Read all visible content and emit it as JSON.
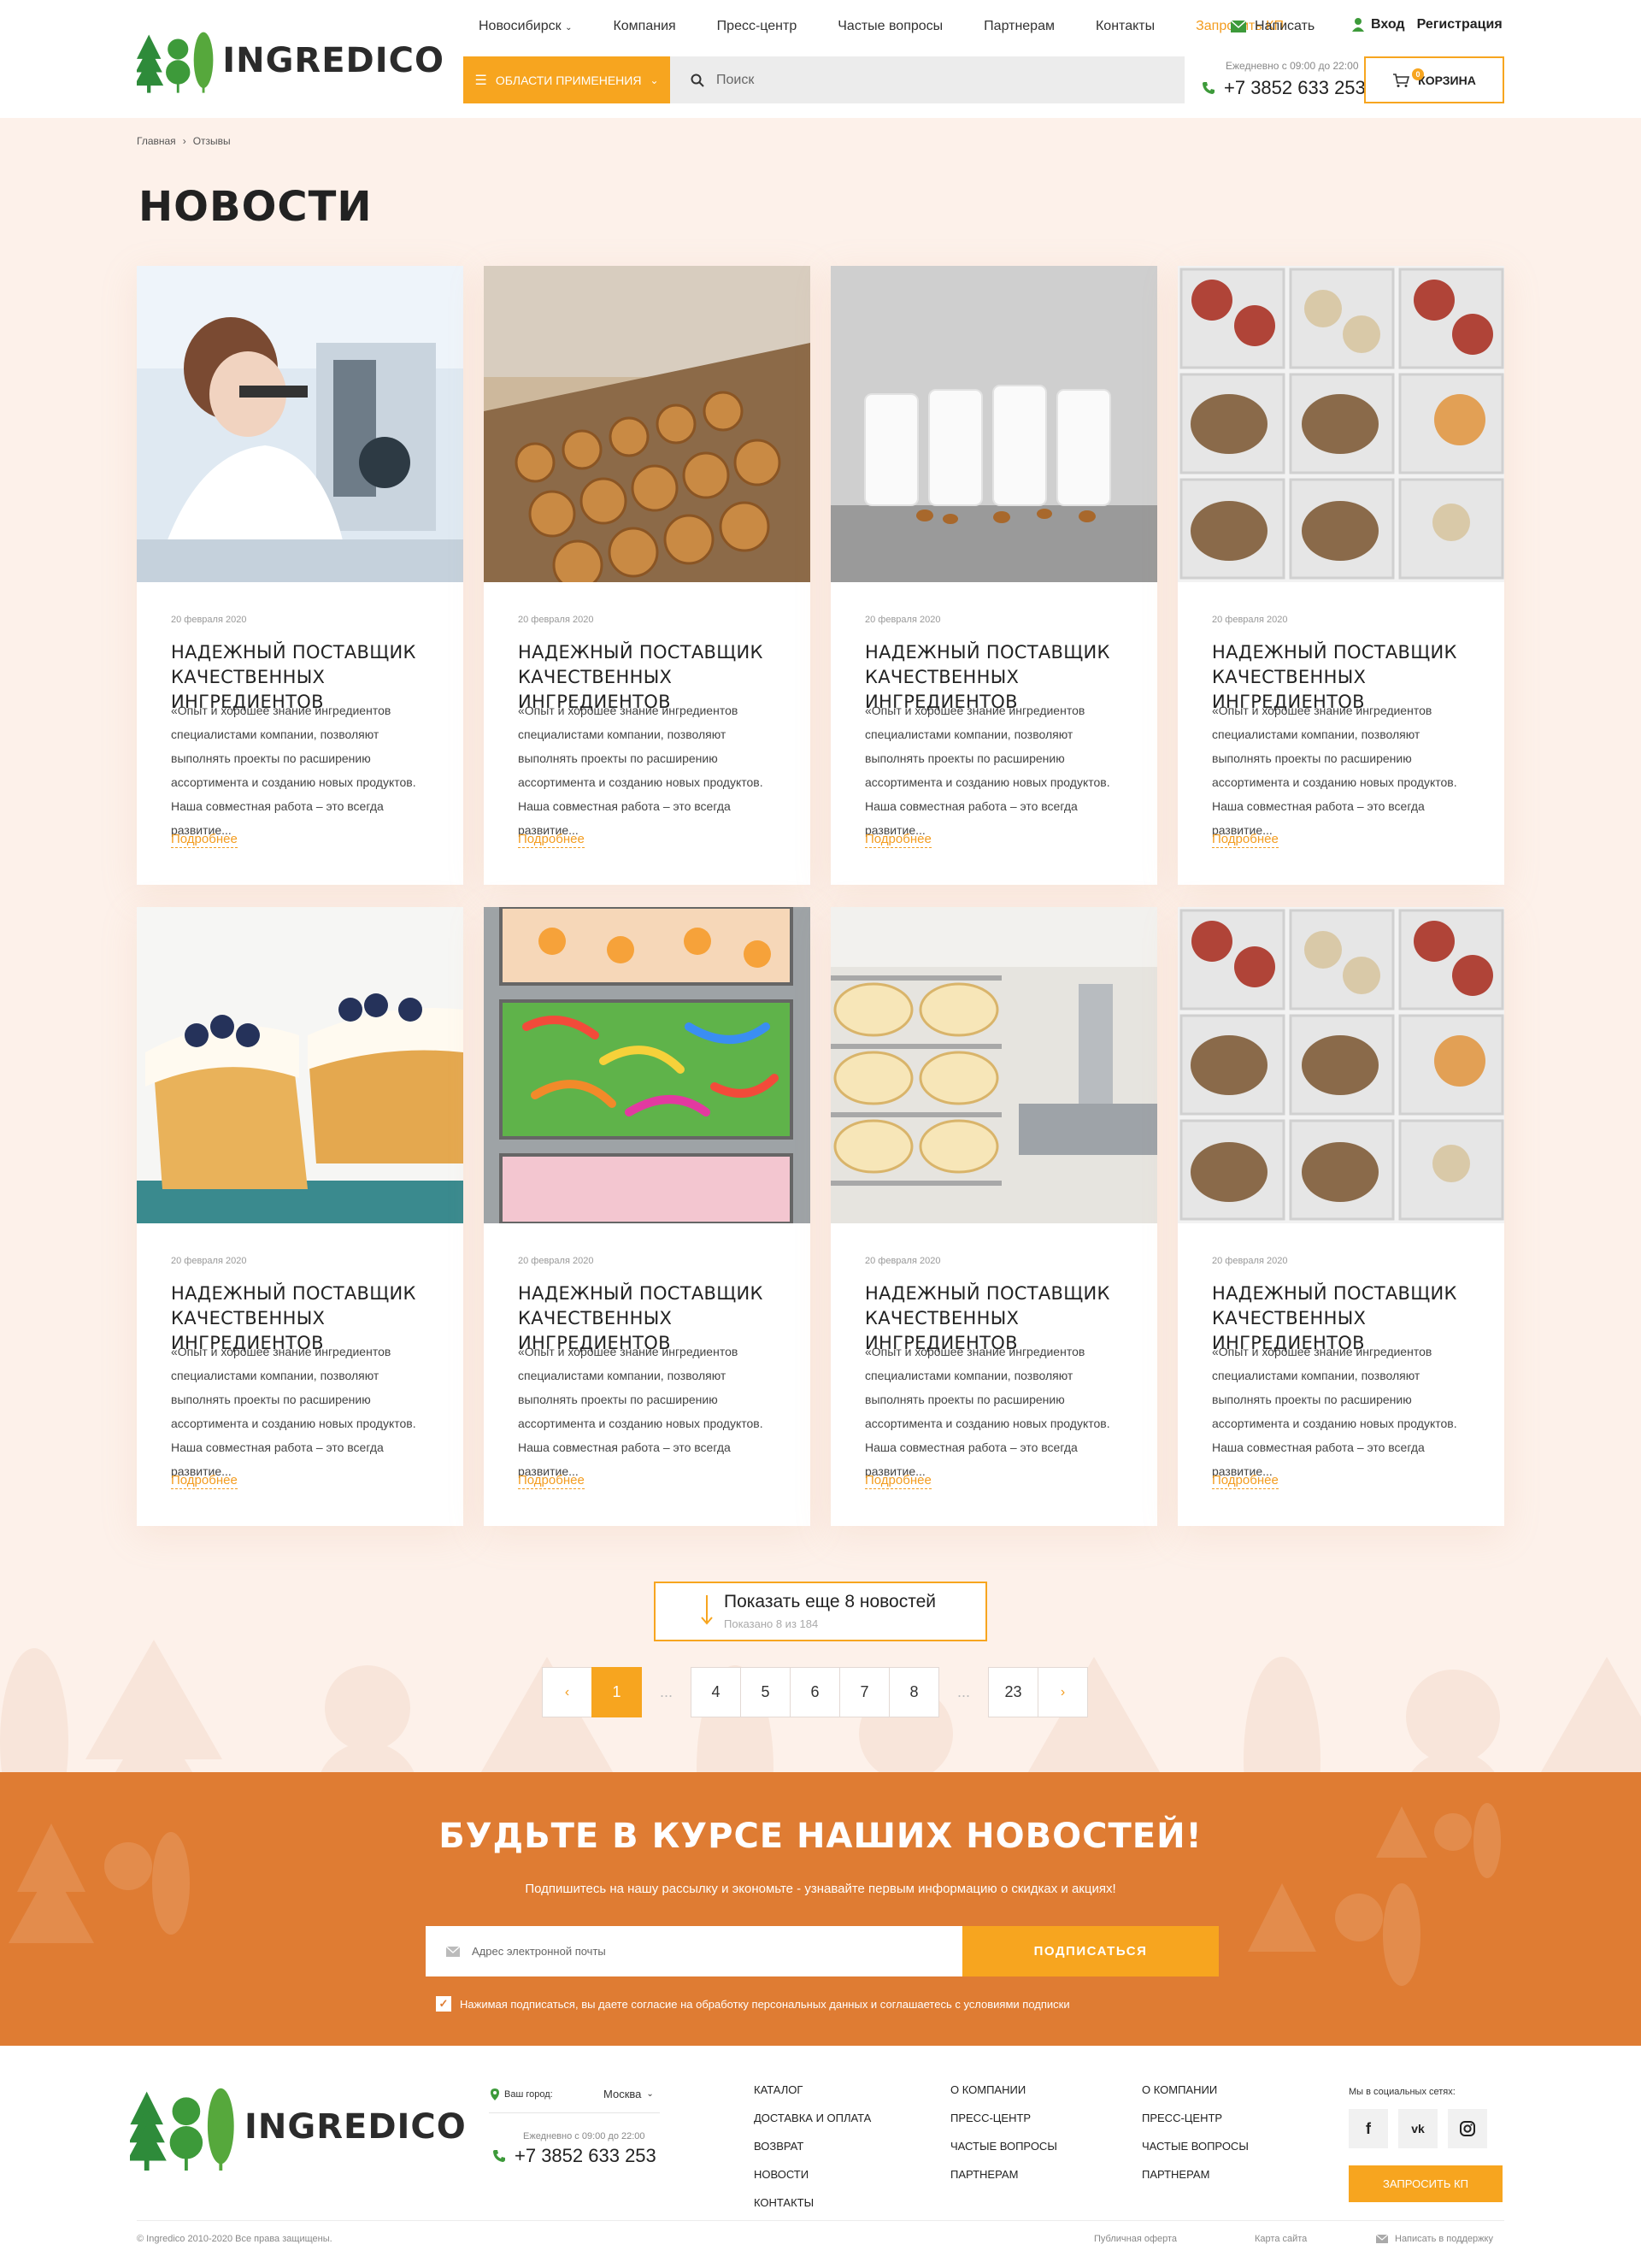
{
  "header": {
    "logo_text": "INGREDICO",
    "nav": {
      "city": "Новосибирск",
      "items": [
        "Компания",
        "Пресс-центр",
        "Частые вопросы",
        "Партнерам",
        "Контакты"
      ],
      "request_kp": "Запросить КП"
    },
    "write": "Написать",
    "login": "Вход",
    "register": "Регистрация",
    "categories_button": "Области применения",
    "search_placeholder": "Поиск",
    "hours": "Ежедневно с 09:00 до 22:00",
    "phone": "+7 3852 633 253",
    "cart_label": "Корзина",
    "cart_count": "0"
  },
  "breadcrumb": [
    "Главная",
    "Отзывы"
  ],
  "page_title": "НОВОСТИ",
  "news": [
    {
      "date": "20 февраля 2020",
      "title": "НАДЕЖНЫЙ ПОСТАВЩИК КАЧЕСТВЕННЫХ ИНГРЕДИЕНТОВ",
      "text": "«Опыт и хорошее знание ингредиентов специалистами компании, позволяют выполнять проекты по расширению ассортимента и созданию новых продуктов. Наша совместная работа – это всегда развитие...",
      "more": "Подробнее",
      "image": "laboratory"
    },
    {
      "date": "20 февраля 2020",
      "title": "НАДЕЖНЫЙ ПОСТАВЩИК КАЧЕСТВЕННЫХ ИНГРЕДИЕНТОВ",
      "text": "«Опыт и хорошее знание ингредиентов специалистами компании, позволяют выполнять проекты по расширению ассортимента и созданию новых продуктов. Наша совместная работа – это всегда развитие...",
      "more": "Подробнее",
      "image": "cookies"
    },
    {
      "date": "20 февраля 2020",
      "title": "НАДЕЖНЫЙ ПОСТАВЩИК КАЧЕСТВЕННЫХ ИНГРЕДИЕНТОВ",
      "text": "«Опыт и хорошее знание ингредиентов специалистами компании, позволяют выполнять проекты по расширению ассортимента и созданию новых продуктов. Наша совместная работа – это всегда развитие...",
      "more": "Подробнее",
      "image": "milk"
    },
    {
      "date": "20 февраля 2020",
      "title": "НАДЕЖНЫЙ ПОСТАВЩИК КАЧЕСТВЕННЫХ ИНГРЕДИЕНТОВ",
      "text": "«Опыт и хорошее знание ингредиентов специалистами компании, позволяют выполнять проекты по расширению ассортимента и созданию новых продуктов. Наша совместная работа – это всегда развитие...",
      "more": "Подробнее",
      "image": "meat"
    },
    {
      "date": "20 февраля 2020",
      "title": "НАДЕЖНЫЙ ПОСТАВЩИК КАЧЕСТВЕННЫХ ИНГРЕДИЕНТОВ",
      "text": "«Опыт и хорошее знание ингредиентов специалистами компании, позволяют выполнять проекты по расширению ассортимента и созданию новых продуктов. Наша совместная работа – это всегда развитие...",
      "more": "Подробнее",
      "image": "cake"
    },
    {
      "date": "20 февраля 2020",
      "title": "НАДЕЖНЫЙ ПОСТАВЩИК КАЧЕСТВЕННЫХ ИНГРЕДИЕНТОВ",
      "text": "«Опыт и хорошее знание ингредиентов специалистами компании, позволяют выполнять проекты по расширению ассортимента и созданию новых продуктов. Наша совместная работа – это всегда развитие...",
      "more": "Подробнее",
      "image": "candy"
    },
    {
      "date": "20 февраля 2020",
      "title": "НАДЕЖНЫЙ ПОСТАВЩИК КАЧЕСТВЕННЫХ ИНГРЕДИЕНТОВ",
      "text": "«Опыт и хорошее знание ингредиентов специалистами компании, позволяют выполнять проекты по расширению ассортимента и созданию новых продуктов. Наша совместная работа – это всегда развитие...",
      "more": "Подробнее",
      "image": "cakes-factory"
    },
    {
      "date": "20 февраля 2020",
      "title": "НАДЕЖНЫЙ ПОСТАВЩИК КАЧЕСТВЕННЫХ ИНГРЕДИЕНТОВ",
      "text": "«Опыт и хорошее знание ингредиентов специалистами компании, позволяют выполнять проекты по расширению ассортимента и созданию новых продуктов. Наша совместная работа – это всегда развитие...",
      "more": "Подробнее",
      "image": "meat"
    }
  ],
  "show_more": {
    "label": "Показать еще 8 новостей",
    "shown": "Показано 8 из 184"
  },
  "pagination": {
    "prev": "‹",
    "next": "›",
    "pages": [
      "1",
      "...",
      "4",
      "5",
      "6",
      "7",
      "8",
      "...",
      "23"
    ],
    "current": "1"
  },
  "subscribe": {
    "title": "БУДЬТЕ В КУРСЕ НАШИХ НОВОСТЕЙ!",
    "text": "Подпишитесь на нашу рассылку и экономьте - узнавайте первым информацию о скидках и акциях!",
    "placeholder": "Адрес электронной почты",
    "button": "Подписаться",
    "consent": "Нажимая подписаться, вы даете согласие на обработку персональных данных и соглашаетесь с условиями подписки"
  },
  "footer": {
    "logo_text": "INGREDICO",
    "city_label": "Ваш город:",
    "city": "Москва",
    "hours": "Ежедневно с 09:00 до 22:00",
    "phone": "+7 3852 633 253",
    "col1": [
      "КАТАЛОГ",
      "ДОСТАВКА И ОПЛАТА",
      "ВОЗВРАТ",
      "НОВОСТИ",
      "КОНТАКТЫ"
    ],
    "col2": [
      "О КОМПАНИИ",
      "ПРЕСС-ЦЕНТР",
      "ЧАСТЫЕ ВОПРОСЫ",
      "ПАРТНЕРАМ"
    ],
    "col3": [
      "О КОМПАНИИ",
      "ПРЕСС-ЦЕНТР",
      "ЧАСТЫЕ ВОПРОСЫ",
      "ПАРТНЕРАМ"
    ],
    "social_label": "Мы в социальных сетях:",
    "social": [
      "f",
      "vk",
      "instagram"
    ],
    "request_kp": "Запросить КП",
    "copyright": "© Ingredico 2010-2020 Все права защищены.",
    "offer": "Публичная оферта",
    "sitemap": "Карта сайта",
    "support": "Написать в поддержку"
  },
  "colors": {
    "accent": "#f7a51f",
    "subscribe_bg": "#df7c33",
    "page_bg": "#fdf1ea",
    "logo_green": "#3d9a3a"
  }
}
